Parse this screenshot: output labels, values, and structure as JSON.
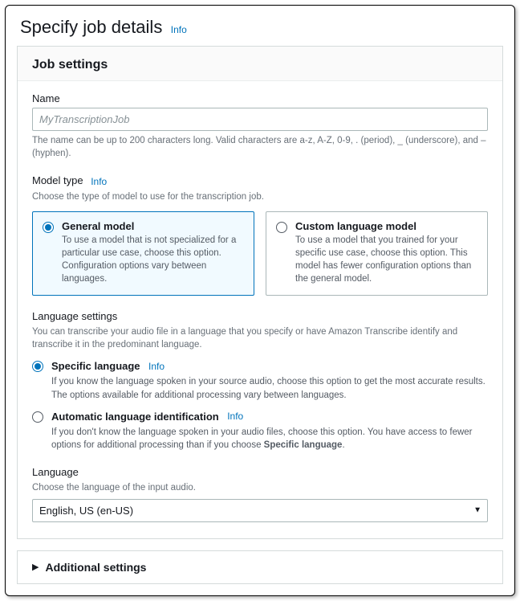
{
  "header": {
    "title": "Specify job details",
    "info": "Info"
  },
  "panel": {
    "title": "Job settings"
  },
  "name_field": {
    "label": "Name",
    "placeholder": "MyTranscriptionJob",
    "hint": "The name can be up to 200 characters long. Valid characters are a-z, A-Z, 0-9, . (period), _ (underscore), and – (hyphen)."
  },
  "model_type": {
    "label": "Model type",
    "info": "Info",
    "hint": "Choose the type of model to use for the transcription job.",
    "options": [
      {
        "title": "General model",
        "desc": "To use a model that is not specialized for a particular use case, choose this option. Configuration options vary between languages."
      },
      {
        "title": "Custom language model",
        "desc": "To use a model that you trained for your specific use case, choose this option. This model has fewer configuration options than the general model."
      }
    ]
  },
  "lang_settings": {
    "label": "Language settings",
    "hint": "You can transcribe your audio file in a language that you specify or have Amazon Transcribe identify and transcribe it in the predominant language.",
    "options": [
      {
        "title": "Specific language",
        "info": "Info",
        "desc": "If you know the language spoken in your source audio, choose this option to get the most accurate results. The options available for additional processing vary between languages."
      },
      {
        "title": "Automatic language identification",
        "info": "Info",
        "desc_pre": "If you don't know the language spoken in your audio files, choose this option. You have access to fewer options for additional processing than if you choose ",
        "desc_bold": "Specific language",
        "desc_post": "."
      }
    ]
  },
  "language": {
    "label": "Language",
    "hint": "Choose the language of the input audio.",
    "value": "English, US (en-US)"
  },
  "additional": {
    "title": "Additional settings"
  }
}
